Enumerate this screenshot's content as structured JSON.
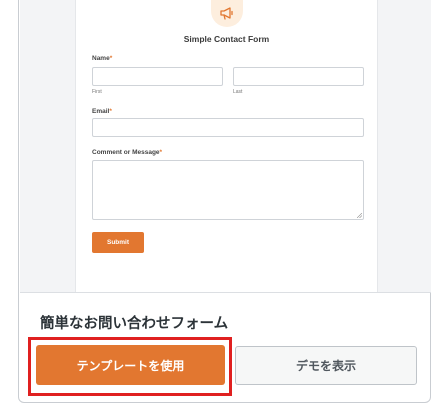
{
  "preview": {
    "icon": "megaphone-icon",
    "form_title": "Simple Contact Form",
    "name_label": "Name",
    "required_mark": "*",
    "first_sublabel": "First",
    "last_sublabel": "Last",
    "email_label": "Email",
    "comment_label": "Comment or Message",
    "submit_label": "Submit"
  },
  "template": {
    "name": "簡単なお問い合わせフォーム",
    "use_template_label": "テンプレートを使用",
    "view_demo_label": "デモを表示"
  },
  "colors": {
    "accent": "#e27730",
    "highlight": "#e02020"
  }
}
